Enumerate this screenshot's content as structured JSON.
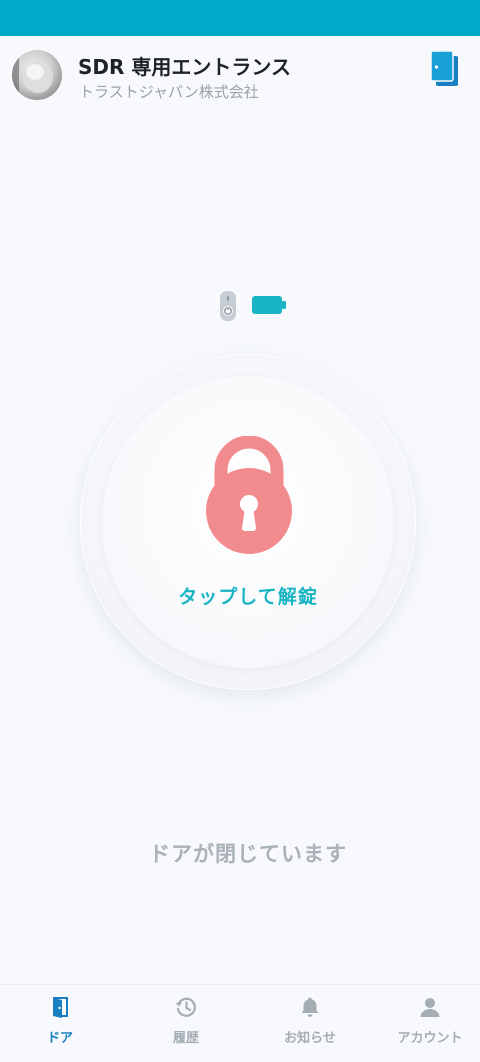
{
  "header": {
    "door_name": "SDR 専用エントランス",
    "company": "トラストジャパン株式会社",
    "switch_icon": "door-list-icon"
  },
  "device": {
    "lock_icon": "smart-lock-icon",
    "battery_icon": "battery-full-icon",
    "battery_level": 1.0
  },
  "unlock": {
    "label": "タップして解錠",
    "icon": "padlock-icon"
  },
  "status": {
    "text": "ドアが閉じています"
  },
  "nav": {
    "items": [
      {
        "label": "ドア",
        "icon": "door-icon",
        "active": true
      },
      {
        "label": "履歴",
        "icon": "history-icon",
        "active": false
      },
      {
        "label": "お知らせ",
        "icon": "bell-icon",
        "active": false
      },
      {
        "label": "アカウント",
        "icon": "person-icon",
        "active": false
      }
    ]
  },
  "colors": {
    "accent": "#00aac8",
    "unlock_text": "#1ab5c4",
    "padlock": "#f28b8e",
    "nav_active": "#1a7fc0",
    "nav_inactive": "#a5adb5",
    "background": "#f7f9fc"
  }
}
